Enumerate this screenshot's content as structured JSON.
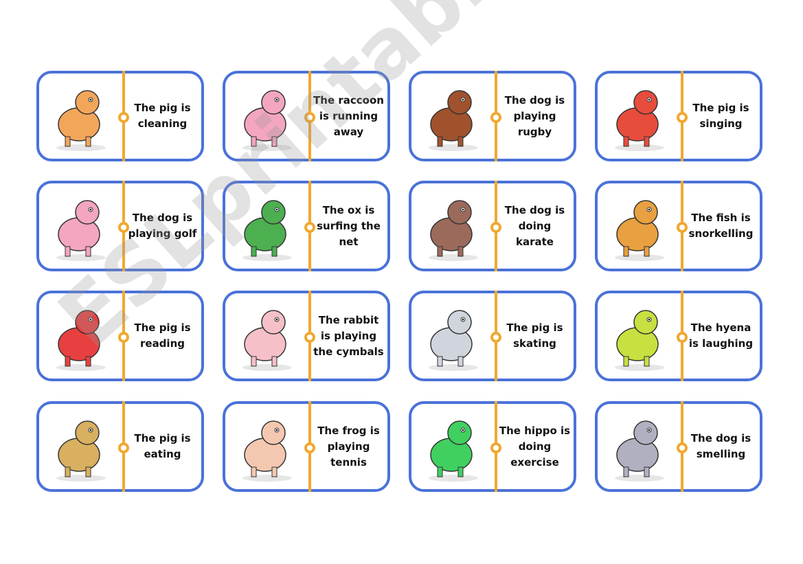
{
  "cards": [
    {
      "text": "The pig is cleaning",
      "picture": "dog-sniffing",
      "color": "#f2a65a"
    },
    {
      "text": "The raccoon is running away",
      "picture": "pig-cleaning",
      "color": "#f4a6c0"
    },
    {
      "text": "The dog is playing rugby",
      "picture": "raccoon-running",
      "color": "#a0522d"
    },
    {
      "text": "The pig is singing",
      "picture": "dog-rugby",
      "color": "#e74c3c"
    },
    {
      "text": "The dog is playing golf",
      "picture": "pig-singing",
      "color": "#f4a6c0"
    },
    {
      "text": "The ox is surfing the net",
      "picture": "ox-golf",
      "color": "#4caf50"
    },
    {
      "text": "The dog is doing karate",
      "picture": "ox-computer",
      "color": "#9b6a5a"
    },
    {
      "text": "The fish is snorkelling",
      "picture": "dog-karate",
      "color": "#e8a040"
    },
    {
      "text": "The pig is reading",
      "picture": "fish-snorkel",
      "color": "#e84040"
    },
    {
      "text": "The rabbit is playing the cymbals",
      "picture": "pig-reading",
      "color": "#f6c0c8"
    },
    {
      "text": "The pig is skating",
      "picture": "rabbit-cymbals",
      "color": "#d0d4dc"
    },
    {
      "text": "The hyena is laughing",
      "picture": "pig-skating",
      "color": "#c8e040"
    },
    {
      "text": "The pig is eating",
      "picture": "hyena-laughing",
      "color": "#d8b060"
    },
    {
      "text": "The frog is playing tennis",
      "picture": "pig-eating",
      "color": "#f4c8b0"
    },
    {
      "text": "The hippo is doing exercise",
      "picture": "frog-tennis",
      "color": "#40d060"
    },
    {
      "text": "The dog is smelling",
      "picture": "hippo-exercise",
      "color": "#b0b0c0"
    }
  ],
  "colors": {
    "border": "#4a72d8",
    "divider": "#f0a830"
  },
  "watermark": "ESLprintables.com"
}
